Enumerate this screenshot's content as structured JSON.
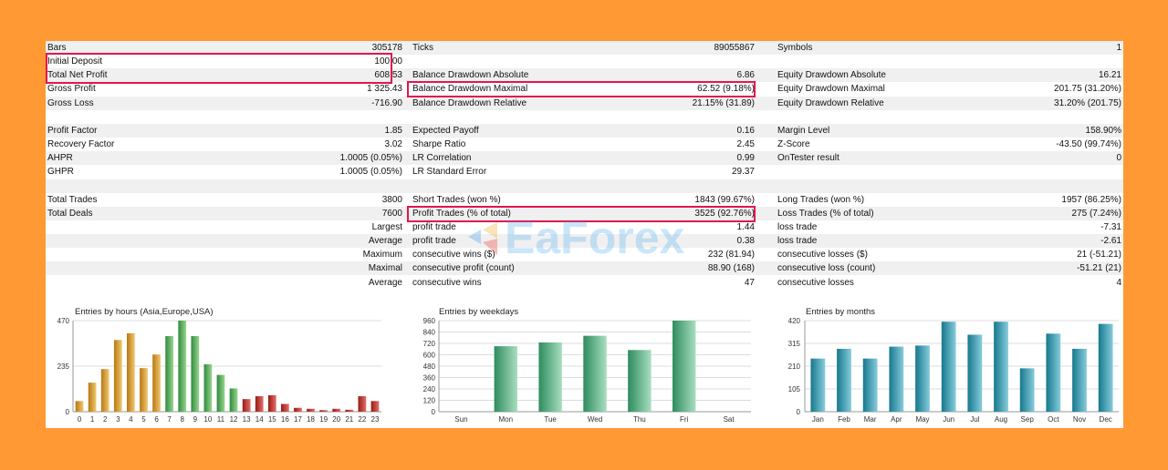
{
  "stats_rows": [
    {
      "cols": [
        {
          "label": "Bars",
          "value": "305178"
        },
        {
          "label": "Ticks",
          "value": "89055867"
        },
        {
          "label": "Symbols",
          "value": "1"
        }
      ]
    },
    {
      "cols": [
        {
          "label": "Initial Deposit",
          "value": "100.00"
        },
        {
          "label": "",
          "value": ""
        },
        {
          "label": "",
          "value": ""
        }
      ]
    },
    {
      "cols": [
        {
          "label": "Total Net Profit",
          "value": "608.53"
        },
        {
          "label": "Balance Drawdown Absolute",
          "value": "6.86"
        },
        {
          "label": "Equity Drawdown Absolute",
          "value": "16.21"
        }
      ]
    },
    {
      "cols": [
        {
          "label": "Gross Profit",
          "value": "1 325.43"
        },
        {
          "label": "Balance Drawdown Maximal",
          "value": "62.52 (9.18%)"
        },
        {
          "label": "Equity Drawdown Maximal",
          "value": "201.75 (31.20%)"
        }
      ]
    },
    {
      "cols": [
        {
          "label": "Gross Loss",
          "value": "-716.90"
        },
        {
          "label": "Balance Drawdown Relative",
          "value": "21.15% (31.89)"
        },
        {
          "label": "Equity Drawdown Relative",
          "value": "31.20% (201.75)"
        }
      ]
    },
    {
      "cols": [
        {
          "label": "",
          "value": ""
        },
        {
          "label": "",
          "value": ""
        },
        {
          "label": "",
          "value": ""
        }
      ]
    },
    {
      "cols": [
        {
          "label": "Profit Factor",
          "value": "1.85"
        },
        {
          "label": "Expected Payoff",
          "value": "0.16"
        },
        {
          "label": "Margin Level",
          "value": "158.90%"
        }
      ]
    },
    {
      "cols": [
        {
          "label": "Recovery Factor",
          "value": "3.02"
        },
        {
          "label": "Sharpe Ratio",
          "value": "2.45"
        },
        {
          "label": "Z-Score",
          "value": "-43.50 (99.74%)"
        }
      ]
    },
    {
      "cols": [
        {
          "label": "AHPR",
          "value": "1.0005 (0.05%)"
        },
        {
          "label": "LR Correlation",
          "value": "0.99"
        },
        {
          "label": "OnTester result",
          "value": "0"
        }
      ]
    },
    {
      "cols": [
        {
          "label": "GHPR",
          "value": "1.0005 (0.05%)"
        },
        {
          "label": "LR Standard Error",
          "value": "29.37"
        },
        {
          "label": "",
          "value": ""
        }
      ]
    },
    {
      "cols": [
        {
          "label": "",
          "value": ""
        },
        {
          "label": "",
          "value": ""
        },
        {
          "label": "",
          "value": ""
        }
      ]
    },
    {
      "cols": [
        {
          "label": "Total Trades",
          "value": "3800"
        },
        {
          "label": "Short Trades (won %)",
          "value": "1843 (99.67%)"
        },
        {
          "label": "Long Trades (won %)",
          "value": "1957 (86.25%)"
        }
      ]
    },
    {
      "cols": [
        {
          "label": "Total Deals",
          "value": "7600"
        },
        {
          "label": "Profit Trades (% of total)",
          "value": "3525 (92.76%)"
        },
        {
          "label": "Loss Trades (% of total)",
          "value": "275 (7.24%)"
        }
      ]
    },
    {
      "cols": [
        {
          "label": "",
          "value": "Largest"
        },
        {
          "label": "profit trade",
          "value": "1.44"
        },
        {
          "label": "loss trade",
          "value": "-7.31"
        }
      ]
    },
    {
      "cols": [
        {
          "label": "",
          "value": "Average"
        },
        {
          "label": "profit trade",
          "value": "0.38"
        },
        {
          "label": "loss trade",
          "value": "-2.61"
        }
      ]
    },
    {
      "cols": [
        {
          "label": "",
          "value": "Maximum"
        },
        {
          "label": "consecutive wins ($)",
          "value": "232 (81.94)"
        },
        {
          "label": "consecutive losses ($)",
          "value": "21 (-51.21)"
        }
      ]
    },
    {
      "cols": [
        {
          "label": "",
          "value": "Maximal"
        },
        {
          "label": "consecutive profit (count)",
          "value": "88.90 (168)"
        },
        {
          "label": "consecutive loss (count)",
          "value": "-51.21 (21)"
        }
      ]
    },
    {
      "cols": [
        {
          "label": "",
          "value": "Average"
        },
        {
          "label": "consecutive wins",
          "value": "47"
        },
        {
          "label": "consecutive losses",
          "value": "4"
        }
      ]
    }
  ],
  "watermark": {
    "text": "EaForex"
  },
  "colors": {
    "background": "#FF9933",
    "highlight": "#E2164F"
  },
  "chart_data": [
    {
      "type": "bar",
      "title": "Entries by hours (Asia,Europe,USA)",
      "categories": [
        "0",
        "1",
        "2",
        "3",
        "4",
        "5",
        "6",
        "7",
        "8",
        "9",
        "10",
        "11",
        "12",
        "13",
        "14",
        "15",
        "16",
        "17",
        "18",
        "19",
        "20",
        "21",
        "22",
        "23"
      ],
      "values": [
        55,
        150,
        220,
        370,
        405,
        225,
        295,
        390,
        470,
        390,
        245,
        190,
        120,
        65,
        80,
        85,
        40,
        20,
        15,
        8,
        15,
        10,
        80,
        55
      ],
      "yticks": [
        "0",
        "235",
        "470"
      ],
      "ylim": [
        0,
        470
      ]
    },
    {
      "type": "bar",
      "title": "Entries by weekdays",
      "categories": [
        "Sun",
        "Mon",
        "Tue",
        "Wed",
        "Thu",
        "Fri",
        "Sat"
      ],
      "values": [
        0,
        690,
        730,
        800,
        650,
        960,
        0
      ],
      "yticks": [
        "0",
        "120",
        "240",
        "360",
        "480",
        "600",
        "720",
        "840",
        "960"
      ],
      "ylim": [
        0,
        960
      ]
    },
    {
      "type": "bar",
      "title": "Entries by months",
      "categories": [
        "Jan",
        "Feb",
        "Mar",
        "Apr",
        "May",
        "Jun",
        "Jul",
        "Aug",
        "Sep",
        "Oct",
        "Nov",
        "Dec"
      ],
      "values": [
        245,
        290,
        245,
        300,
        305,
        415,
        355,
        415,
        200,
        360,
        290,
        405
      ],
      "yticks": [
        "0",
        "105",
        "210",
        "315",
        "420"
      ],
      "ylim": [
        0,
        420
      ]
    }
  ]
}
